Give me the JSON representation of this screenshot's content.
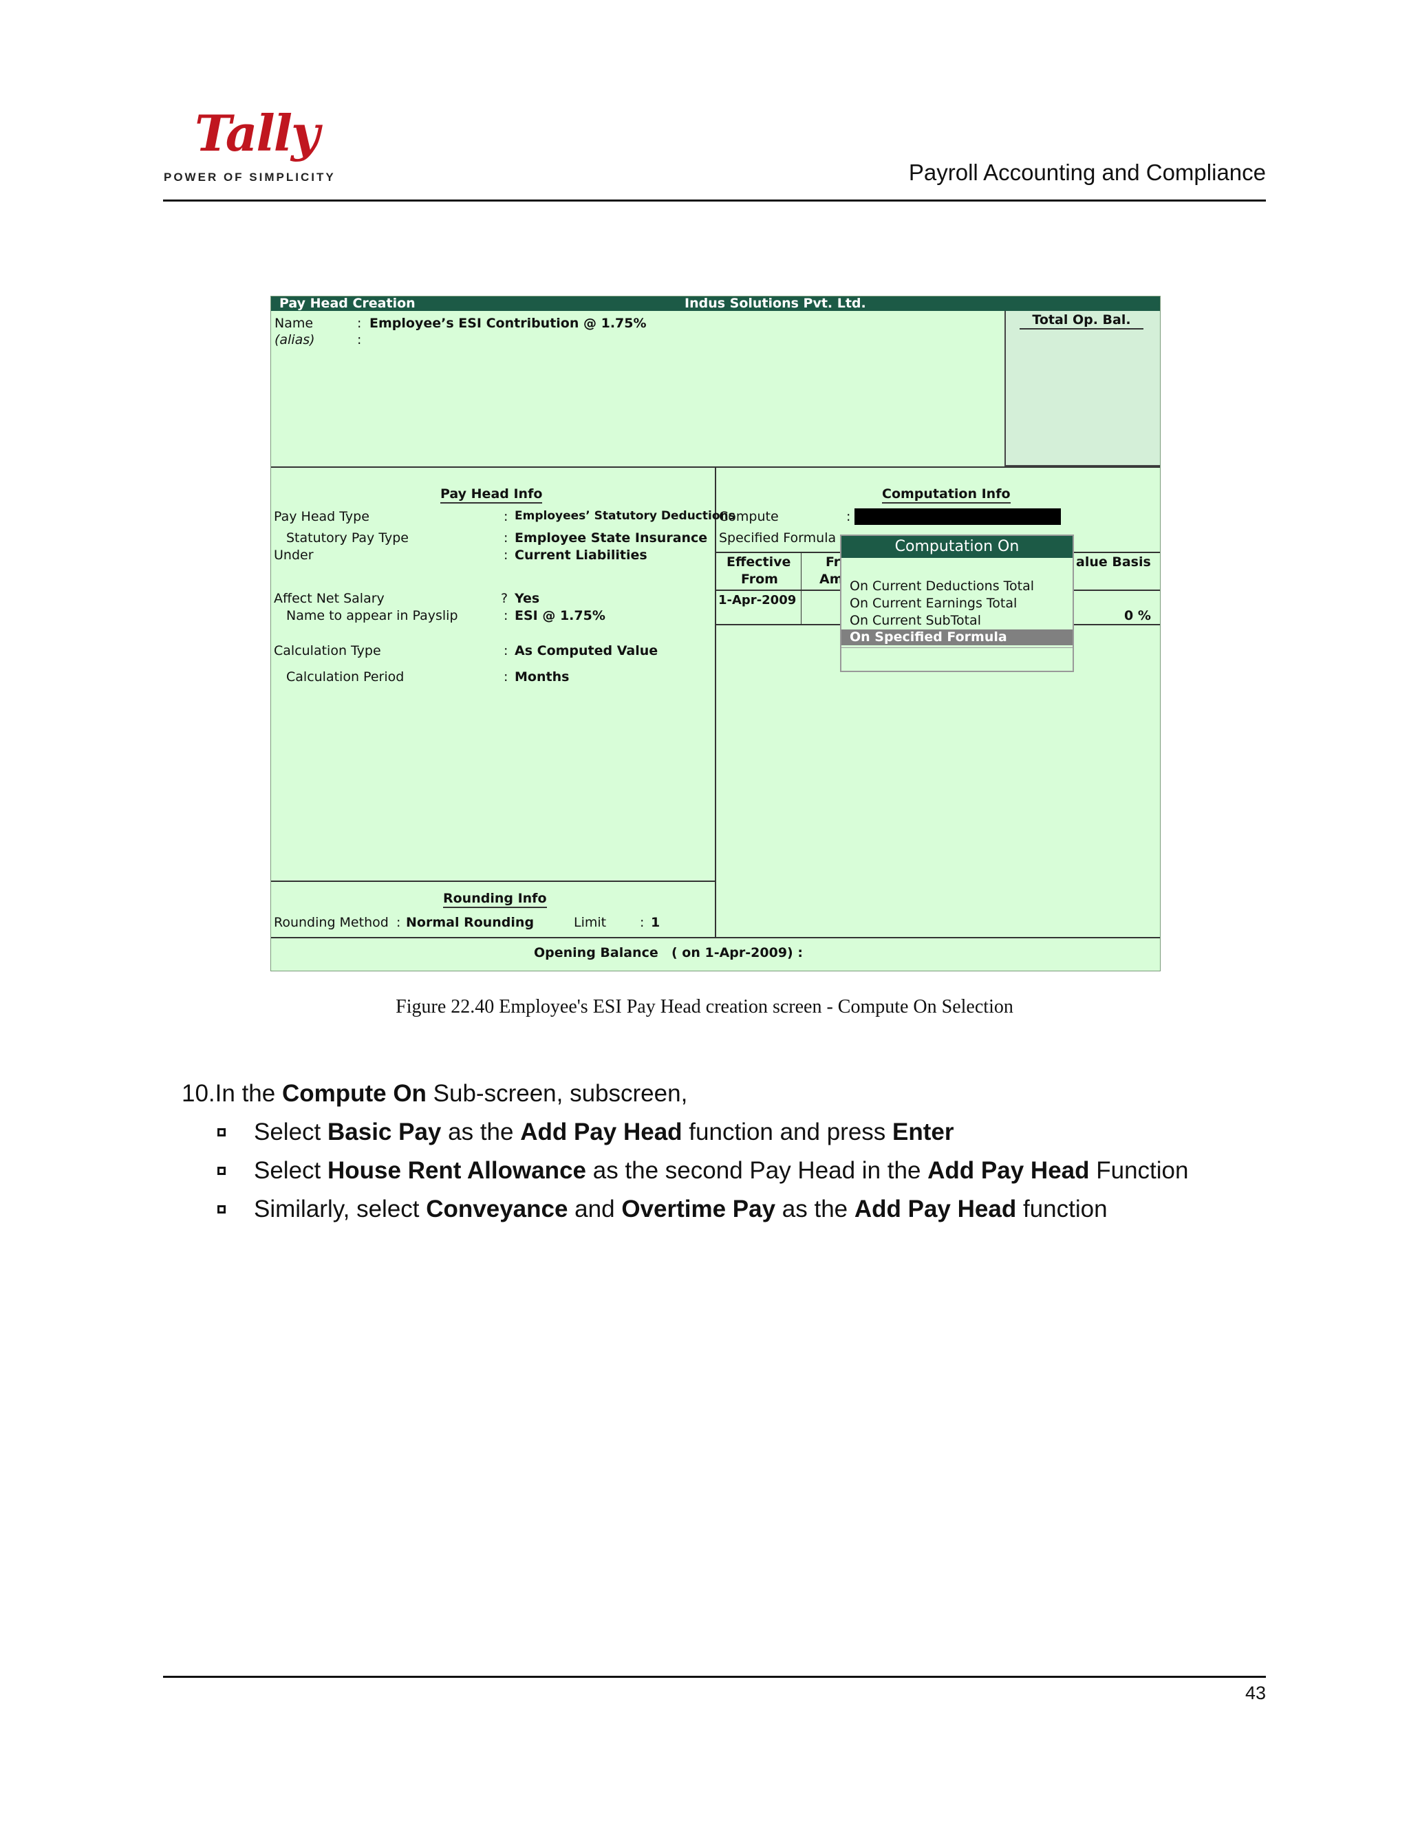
{
  "header": {
    "logo_word": "Tally",
    "logo_tagline": "POWER OF SIMPLICITY",
    "doc_title": "Payroll Accounting and Compliance"
  },
  "screen": {
    "titlebar": {
      "left": "Pay Head  Creation",
      "center": "Indus Solutions Pvt. Ltd."
    },
    "name_label": "Name",
    "name_value": "Employee’s ESI Contribution @ 1.75%",
    "alias_label": "(alias)",
    "total_op_bal": "Total Op. Bal.",
    "pay_head_info": {
      "heading": "Pay Head Info",
      "rows": [
        {
          "label": "Pay Head Type",
          "sep": ":",
          "value": "Employees’ Statutory Deductions"
        },
        {
          "label": "Statutory Pay Type",
          "sep": ":",
          "value": "Employee State Insurance"
        },
        {
          "label": "Under",
          "sep": ":",
          "value": "Current Liabilities"
        },
        {
          "label": "Affect Net Salary",
          "sep": "?",
          "value": "Yes"
        },
        {
          "label": "Name to appear in Payslip",
          "sep": ":",
          "value": "ESI  @ 1.75%"
        },
        {
          "label": "Calculation Type",
          "sep": ":",
          "value": "As Computed Value"
        },
        {
          "label": "Calculation Period",
          "sep": ":",
          "value": "Months"
        }
      ]
    },
    "computation_info": {
      "heading": "Computation Info",
      "compute_label": "Compute",
      "specified_formula_label": "Specified Formula",
      "col_effective_from_1": "Effective",
      "col_effective_from_2": "From",
      "col_from_amt_1": "Fr",
      "col_from_amt_2": "Am",
      "col_value_basis": "alue Basis",
      "row_date": "1-Apr-2009",
      "row_value": "0 %"
    },
    "popup": {
      "title": "Computation On",
      "options": [
        "On Current Deductions Total",
        "On Current Earnings Total",
        "On Current SubTotal"
      ],
      "selected": "On Specified Formula"
    },
    "rounding_info": {
      "heading": "Rounding Info",
      "method_label": "Rounding Method",
      "method_value": "Normal Rounding",
      "limit_label": "Limit",
      "limit_value": "1"
    },
    "opening_balance": "Opening Balance",
    "opening_balance_date": "( on 1-Apr-2009)  :"
  },
  "caption": "Figure 22.40  Employee's ESI Pay Head creation screen - Compute On Selection",
  "steps": {
    "intro_prefix": "10.In the ",
    "intro_bold": "Compute On",
    "intro_suffix": " Sub-screen, subscreen,",
    "b1": {
      "t1": "Select ",
      "b1": "Basic Pay",
      "t2": " as the ",
      "b2": "Add Pay Head",
      "t3": " function and press ",
      "b3": "Enter"
    },
    "b2": {
      "t1": "Select ",
      "b1": "House Rent Allowance",
      "t2": " as the second Pay Head in the ",
      "b2": "Add Pay Head",
      "t3": " Function"
    },
    "b3": {
      "t1": "Similarly, select ",
      "b1": "Conveyance",
      "t2": " and ",
      "b2": "Overtime Pay",
      "t3": " as the ",
      "b3": "Add Pay Head",
      "t4": " function"
    }
  },
  "page_number": "43"
}
